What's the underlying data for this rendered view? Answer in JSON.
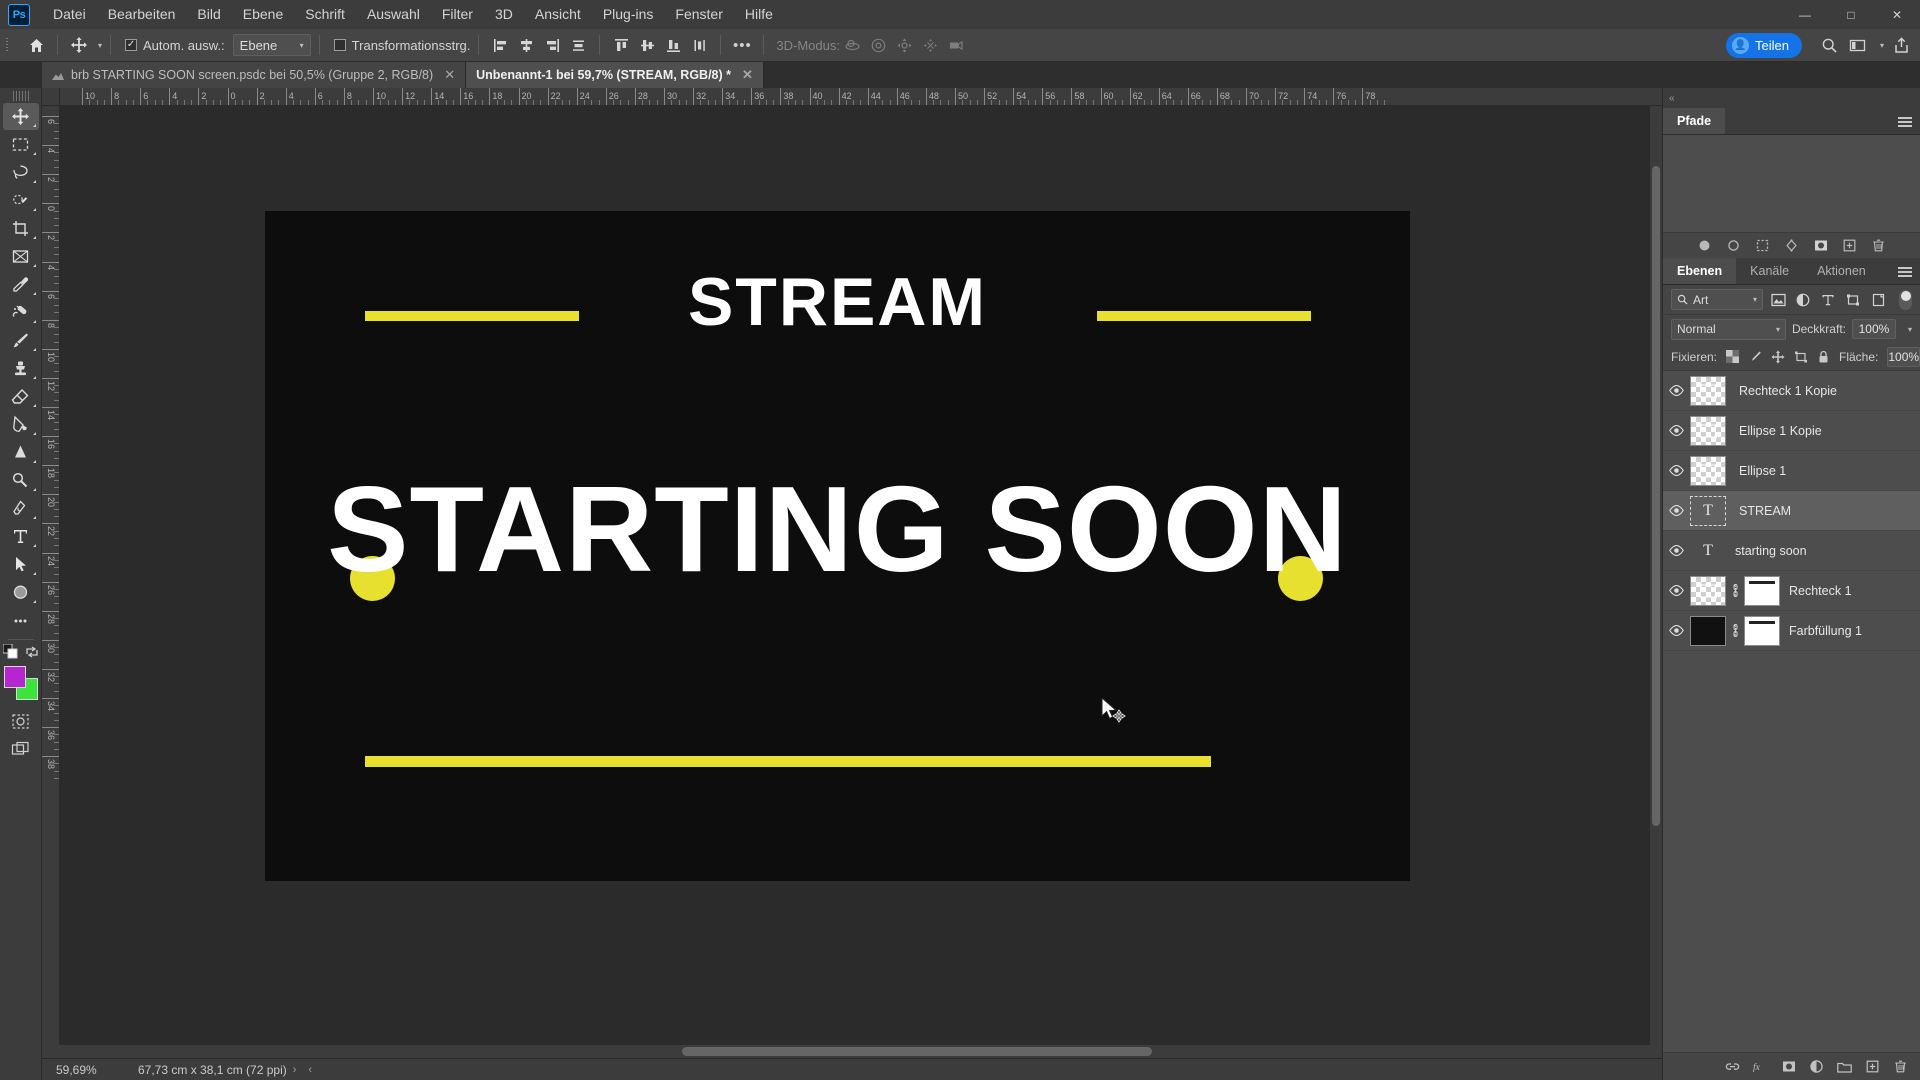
{
  "app": {
    "logo": "Ps"
  },
  "menubar": {
    "items": [
      "Datei",
      "Bearbeiten",
      "Bild",
      "Ebene",
      "Schrift",
      "Auswahl",
      "Filter",
      "3D",
      "Ansicht",
      "Plug-ins",
      "Fenster",
      "Hilfe"
    ],
    "window_controls": {
      "minimize": "—",
      "maximize": "□",
      "close": "✕"
    }
  },
  "optionsbar": {
    "home_icon": "home-icon",
    "tool_icon": "move-tool-icon",
    "auto_select_label": "Autom. ausw.:",
    "auto_select_checked": true,
    "scope_value": "Ebene",
    "transform_controls_label": "Transformationsstrg.",
    "transform_controls_checked": false,
    "mode_3d_label": "3D-Modus:",
    "more_label": "•••",
    "share_label": "Teilen",
    "share_color": "#1473e6",
    "align_icons": [
      "align-left-icon",
      "align-center-h-icon",
      "align-right-icon",
      "distribute-h-icon"
    ],
    "align_icons2": [
      "align-top-icon",
      "align-center-v-icon",
      "align-bottom-icon",
      "distribute-v-icon"
    ],
    "right_icons": [
      "search-icon",
      "workspace-icon",
      "chevron-down-icon",
      "export-icon"
    ]
  },
  "tabs": [
    {
      "title": "brb STARTING SOON screen.psdc bei 50,5% (Gruppe 2, RGB/8)",
      "active": false,
      "close": "✕"
    },
    {
      "title": "Unbenannt-1 bei 59,7% (STREAM, RGB/8) *",
      "active": true,
      "close": "✕"
    }
  ],
  "toolbar": {
    "tools": [
      {
        "name": "move-tool",
        "active": true
      },
      {
        "name": "rectangular-marquee-tool",
        "active": false
      },
      {
        "name": "lasso-tool",
        "active": false
      },
      {
        "name": "object-selection-tool",
        "active": false
      },
      {
        "name": "crop-tool",
        "active": false
      },
      {
        "name": "frame-tool",
        "active": false
      },
      {
        "name": "eyedropper-tool",
        "active": false
      },
      {
        "name": "healing-brush-tool",
        "active": false
      },
      {
        "name": "brush-tool",
        "active": false
      },
      {
        "name": "clone-stamp-tool",
        "active": false
      },
      {
        "name": "eraser-tool",
        "active": false
      },
      {
        "name": "gradient-tool",
        "active": false
      },
      {
        "name": "blur-tool",
        "active": false
      },
      {
        "name": "dodge-tool",
        "active": false
      },
      {
        "name": "pen-tool",
        "active": false
      },
      {
        "name": "type-tool",
        "active": false
      },
      {
        "name": "path-selection-tool",
        "active": false
      },
      {
        "name": "ellipse-tool",
        "active": false
      },
      {
        "name": "more-tools",
        "active": false
      }
    ],
    "foreground_color": "#b526d1",
    "background_color": "#3ce33c",
    "quick_mask_icon": "quick-mask-icon",
    "screen_mode_icon": "screen-mode-icon",
    "swap_icon": "swap-colors-icon"
  },
  "rulers": {
    "unit": "cm",
    "h_labels": [
      "10",
      "8",
      "6",
      "4",
      "2",
      "0",
      "2",
      "4",
      "6",
      "8",
      "10",
      "12",
      "14",
      "16",
      "18",
      "20",
      "22",
      "24",
      "26",
      "28",
      "30",
      "32",
      "34",
      "36",
      "38",
      "40",
      "42",
      "44",
      "46",
      "48",
      "50",
      "52",
      "54",
      "56",
      "58",
      "60",
      "62",
      "64",
      "66",
      "68",
      "70",
      "72",
      "74",
      "76",
      "78"
    ],
    "v_labels": [
      "6",
      "4",
      "2",
      "0",
      "2",
      "4",
      "6",
      "8",
      "10",
      "12",
      "14",
      "16",
      "18",
      "20",
      "22",
      "24",
      "26",
      "28",
      "30",
      "32",
      "34",
      "36",
      "38"
    ]
  },
  "canvas": {
    "background": "#0d0d0d",
    "accent": "#e7e02f",
    "title_text": "STREAM",
    "headline_text": "STARTING SOON",
    "text_color": "#ffffff",
    "elements": [
      {
        "name": "bar-left-top",
        "type": "line"
      },
      {
        "name": "bar-right-top",
        "type": "line"
      },
      {
        "name": "bar-bottom",
        "type": "line"
      },
      {
        "name": "dot-left",
        "type": "circle"
      },
      {
        "name": "dot-right",
        "type": "circle"
      }
    ]
  },
  "statusbar": {
    "zoom": "59,69%",
    "dimensions": "67,73 cm x 38,1 cm (72 ppi)",
    "next_arrow": "›",
    "prev_arrow": "‹"
  },
  "paths_panel": {
    "tab_label": "Pfade",
    "menu_icon": "panel-menu-icon",
    "footer_icons": [
      "fill-path-icon",
      "stroke-path-icon",
      "load-selection-icon",
      "make-work-path-icon",
      "add-mask-icon",
      "new-path-icon",
      "delete-path-icon"
    ]
  },
  "layers_panel": {
    "tabs": [
      {
        "label": "Ebenen",
        "active": true
      },
      {
        "label": "Kanäle",
        "active": false
      },
      {
        "label": "Aktionen",
        "active": false
      }
    ],
    "menu_icon": "panel-menu-icon",
    "filter": {
      "search_icon": "search-icon",
      "kind_label": "Art",
      "filter_icons": [
        "filter-pixel-icon",
        "filter-adjustment-icon",
        "filter-type-icon",
        "filter-shape-icon",
        "filter-smart-icon"
      ],
      "toggle_icon": "filter-toggle-switch"
    },
    "blend_mode": "Normal",
    "opacity_label": "Deckkraft:",
    "opacity_value": "100%",
    "lock_label": "Fixieren:",
    "lock_icons": [
      "lock-transparency-icon",
      "lock-image-icon",
      "lock-position-icon",
      "lock-artboard-icon",
      "lock-all-icon"
    ],
    "fill_label": "Fläche:",
    "fill_value": "100%",
    "layers": [
      {
        "name": "Rechteck 1 Kopie",
        "visible": true,
        "selected": false,
        "type": "shape",
        "has_mask": false,
        "linked": false
      },
      {
        "name": "Ellipse 1 Kopie",
        "visible": true,
        "selected": false,
        "type": "shape",
        "has_mask": false,
        "linked": false
      },
      {
        "name": "Ellipse 1",
        "visible": true,
        "selected": false,
        "type": "shape",
        "has_mask": false,
        "linked": false
      },
      {
        "name": "STREAM",
        "visible": true,
        "selected": true,
        "type": "text",
        "has_mask": false,
        "linked": false
      },
      {
        "name": "starting soon",
        "visible": true,
        "selected": false,
        "type": "text",
        "has_mask": false,
        "linked": false
      },
      {
        "name": "Rechteck 1",
        "visible": true,
        "selected": false,
        "type": "shape",
        "has_mask": true,
        "linked": true
      },
      {
        "name": "Farbfüllung 1",
        "visible": true,
        "selected": false,
        "type": "fill",
        "has_mask": true,
        "linked": true
      }
    ],
    "footer_icons": [
      "link-layers-icon",
      "layer-style-icon",
      "add-mask-icon",
      "new-fill-layer-icon",
      "new-group-icon",
      "new-layer-icon",
      "delete-layer-icon"
    ]
  }
}
